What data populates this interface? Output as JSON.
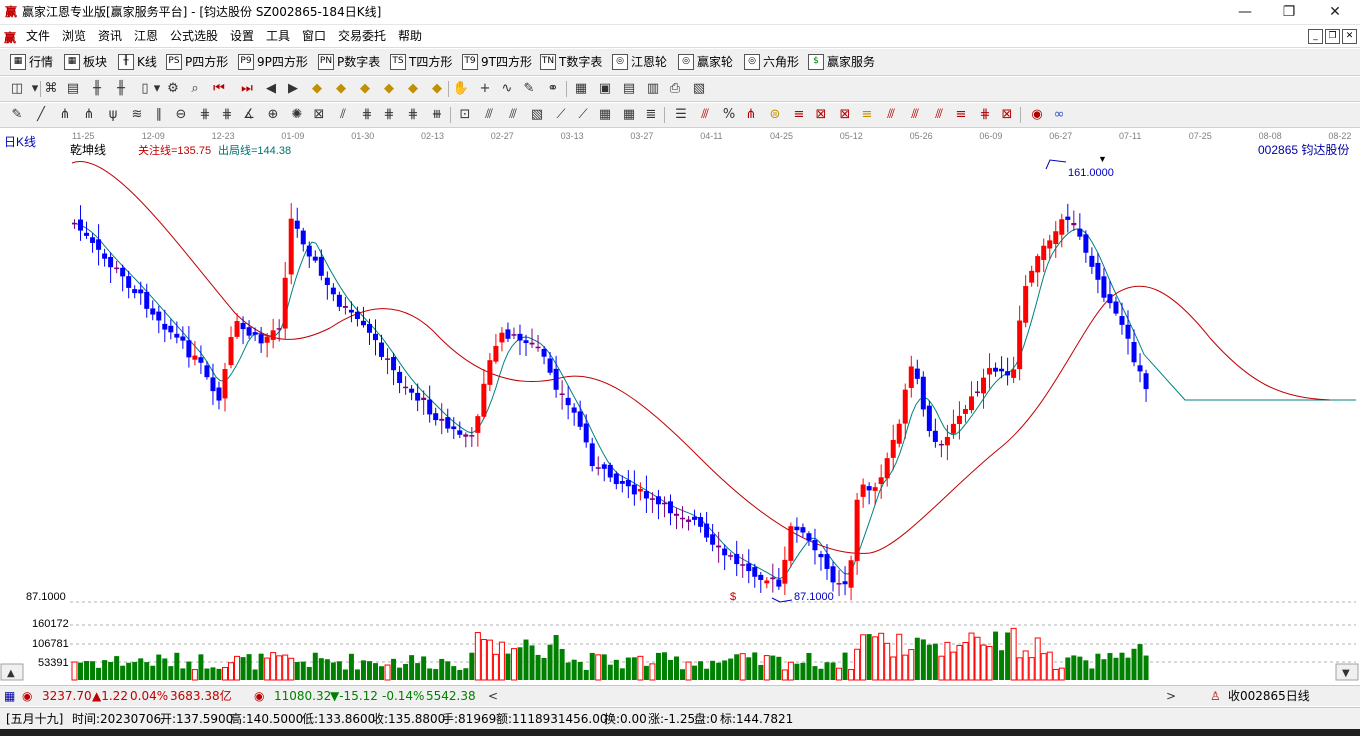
{
  "window": {
    "title": "赢家江恩专业版[赢家服务平台] - [钧达股份   SZ002865-184日K线]",
    "logo_glyph": "赢",
    "min_label": "—",
    "max_label": "❐",
    "close_label": "✕"
  },
  "menu": {
    "logo_glyph": "赢",
    "items": [
      "文件",
      "浏览",
      "资讯",
      "江恩",
      "公式选股",
      "设置",
      "工具",
      "窗口",
      "交易委托",
      "帮助"
    ],
    "mdi_min": "_",
    "mdi_restore": "❐",
    "mdi_close": "✕"
  },
  "toolbar": {
    "items": [
      {
        "icon": "▦",
        "label": "行情"
      },
      {
        "icon": "▦",
        "label": "板块"
      },
      {
        "icon": "╫",
        "label": "K线"
      },
      {
        "icon": "PS",
        "label": "P四方形"
      },
      {
        "icon": "P9",
        "label": "9P四方形"
      },
      {
        "icon": "PN",
        "label": "P数字表"
      },
      {
        "icon": "TS",
        "label": "T四方形"
      },
      {
        "icon": "T9",
        "label": "9T四方形"
      },
      {
        "icon": "TN",
        "label": "T数字表"
      },
      {
        "icon": "◎",
        "label": "江恩轮"
      },
      {
        "icon": "◎",
        "label": "赢家轮"
      },
      {
        "icon": "◎",
        "label": "六角形"
      },
      {
        "icon": "$",
        "label": "赢家服务"
      }
    ]
  },
  "chart": {
    "period_label": "日K线",
    "indicator_name": "乾坤线",
    "focus_line_label": "关注线=135.75",
    "exit_line_label": "出局线=144.38",
    "stock_label": "002865  钧达股份",
    "high_marker": "161.0000",
    "low_marker": "87.1000",
    "price_axis_label": "87.1000",
    "dollar_marker": "$",
    "volume_labels": [
      "160172",
      "106781",
      "53391"
    ],
    "date_labels": [
      "11-25",
      "12-09",
      "12-23",
      "01-09",
      "01-30",
      "02-13",
      "02-27",
      "03-13",
      "03-27",
      "04-11",
      "04-25",
      "05-12",
      "05-26",
      "06-09",
      "06-27",
      "07-11",
      "07-25",
      "08-08",
      "08-22"
    ],
    "colors": {
      "up": "#ff0000",
      "down": "#0000ff",
      "neutral": "#800080",
      "vol_up": "#ff0000",
      "vol_down": "#008000",
      "ma_red": "#c00000",
      "ma_teal": "#008080"
    }
  },
  "chart_data": {
    "type": "candlestick",
    "ylim": [
      87.1,
      161.0
    ],
    "high": 161.0,
    "low": 87.1,
    "last_bar": {
      "date": "20230706",
      "open": 137.59,
      "high": 140.5,
      "low": 133.86,
      "close": 135.88,
      "volume": 81969,
      "amount": 1118931456.0
    }
  },
  "index_bar": {
    "sh_value": "3237.70",
    "sh_change": "▲1.22",
    "sh_pct": "0.04%",
    "sh_amount": "3683.38亿",
    "sz_value": "11080.32",
    "sz_change": "▼-15.12",
    "sz_pct": "-0.14%",
    "sz_amount": "5542.38",
    "fav_label": "收002865日线",
    "nav_left": "<",
    "nav_right": ">"
  },
  "status": {
    "lunar": "[五月十九]",
    "time": "时间:20230706",
    "open": "开:137.5900",
    "high": "高:140.5000",
    "low": "低:133.8600",
    "close": "收:135.8800",
    "volume": "手:81969",
    "amount": "额:1118931456.00",
    "turnover": "换:0.00",
    "change": "涨:-1.25",
    "position": "盘:0",
    "mark": "标:144.7821"
  }
}
